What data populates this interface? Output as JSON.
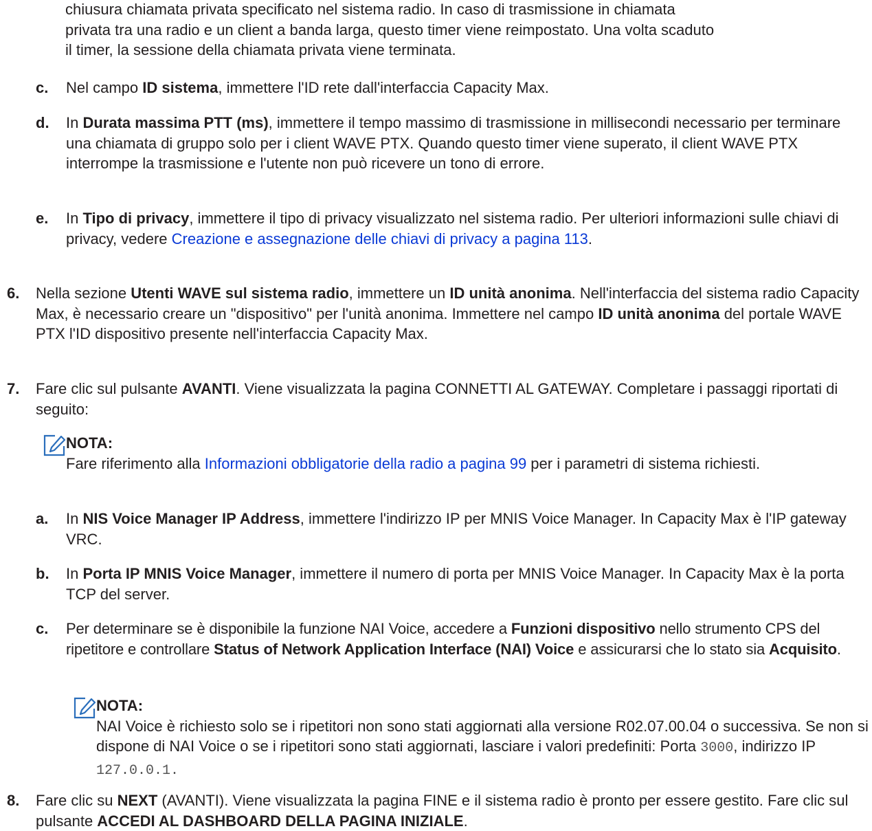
{
  "top_para": {
    "l1": "chiusura chiamata privata specificato nel sistema radio. In caso di trasmissione in chiamata",
    "l2": "privata tra una radio e un client a banda larga, questo timer viene reimpostato. Una volta scaduto",
    "l3": "il timer, la sessione della chiamata privata viene terminata."
  },
  "step_c1": {
    "label": "c.",
    "t1": "Nel campo ",
    "b1": "ID sistema",
    "t2": ", immettere l'ID rete dall'interfaccia Capacity Max."
  },
  "step_d1": {
    "label": "d.",
    "t1": "In ",
    "b1": "Durata massima PTT (ms)",
    "t2": ", immettere il tempo massimo di trasmissione in millisecondi necessario per terminare una chiamata di gruppo solo per i client WAVE PTX. Quando questo timer viene superato, il client WAVE PTX interrompe la trasmissione e l'utente non può ricevere un tono di errore."
  },
  "step_e1": {
    "label": "e.",
    "t1": "In ",
    "b1": "Tipo di privacy",
    "t2": ", immettere il tipo di privacy visualizzato nel sistema radio. Per ulteriori informazioni sulle chiavi di privacy, vedere ",
    "link": "Creazione e assegnazione delle chiavi di privacy a pagina 113",
    "t3": "."
  },
  "step_6": {
    "label": "6.",
    "t1": "Nella sezione ",
    "b1": "Utenti WAVE sul sistema radio",
    "t2": ", immettere un ",
    "b2": "ID unità anonima",
    "t3": ". Nell'interfaccia del sistema radio Capacity Max, è necessario creare un \"dispositivo\" per l'unità anonima. Immettere nel campo ",
    "b3": "ID unità anonima",
    "t4": " del portale WAVE PTX l'ID dispositivo presente nell'interfaccia Capacity Max."
  },
  "step_7": {
    "label": "7.",
    "t1": "Fare clic sul pulsante ",
    "b1": "AVANTI",
    "t2": ". Viene visualizzata la pagina CONNETTI AL GATEWAY. Completare i passaggi riportati di seguito:"
  },
  "note_1": {
    "title": "NOTA:",
    "t1": "Fare riferimento alla ",
    "link": "Informazioni obbligatorie della radio a pagina 99",
    "t2": " per i parametri di sistema richiesti."
  },
  "step_a2": {
    "label": "a.",
    "t1": "In ",
    "b1": "NIS Voice Manager IP Address",
    "t2": ", immettere l'indirizzo IP per MNIS Voice Manager. In Capacity Max è l'IP gateway VRC."
  },
  "step_b2": {
    "label": "b.",
    "t1": "In ",
    "b1": "Porta IP MNIS Voice Manager",
    "t2": ", immettere il numero di porta per MNIS Voice Manager. In Capacity Max è la porta TCP del server."
  },
  "step_c2": {
    "label": "c.",
    "t1": "Per determinare se è disponibile la funzione NAI Voice, accedere a ",
    "b1": "Funzioni dispositivo",
    "t2": " nello strumento CPS del ripetitore e controllare ",
    "b2": "Status of Network Application Interface (NAI) Voice",
    "t3": " e assicurarsi che lo stato sia ",
    "b3": "Acquisito",
    "t4": "."
  },
  "note_2": {
    "title": "NOTA:",
    "t1": "NAI Voice è richiesto solo se i ripetitori non sono stati aggiornati alla versione R02.07.00.04 o successiva. Se non si dispone di NAI Voice o se i ripetitori sono stati aggiornati, lasciare i valori predefiniti: Porta ",
    "c1": "3000",
    "t2": ", indirizzo IP ",
    "c2": "127.0.0.1."
  },
  "step_8": {
    "label": "8.",
    "t1": "Fare clic su ",
    "b1": "NEXT",
    "t2": " (AVANTI). Viene visualizzata la pagina FINE e il sistema radio è pronto per essere gestito. Fare clic sul pulsante ",
    "b2": "ACCEDI AL DASHBOARD DELLA PAGINA INIZIALE",
    "t3": "."
  },
  "colors": {
    "text": "#231f20",
    "link": "#0a3ad6",
    "icon": "#2a6ebb"
  }
}
